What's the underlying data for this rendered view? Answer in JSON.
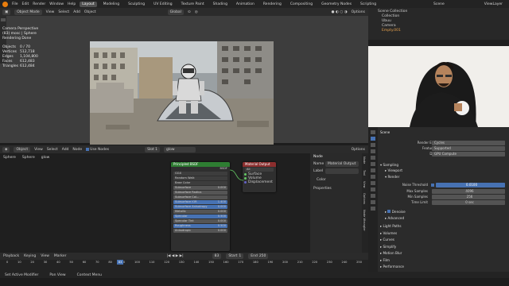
{
  "topbar": {
    "menus": [
      "File",
      "Edit",
      "Render",
      "Window",
      "Help"
    ],
    "workspaces": [
      "Layout",
      "Modeling",
      "Sculpting",
      "UV Editing",
      "Texture Paint",
      "Shading",
      "Animation",
      "Rendering",
      "Compositing",
      "Geometry Nodes",
      "Scripting"
    ],
    "active_workspace": "Layout",
    "scene": "Scene",
    "view_layer": "ViewLayer"
  },
  "viewport": {
    "mode": "Object Mode",
    "menus": [
      "View",
      "Select",
      "Add",
      "Object"
    ],
    "transform": "Global",
    "options": "Options",
    "overlay": {
      "camera": "Camera Perspective",
      "object": "(83) mosc | Sphere",
      "status": "Rendering Done",
      "stats": [
        {
          "label": "Objects",
          "value": "0 / 70"
        },
        {
          "label": "Vertices",
          "value": "512,718"
        },
        {
          "label": "Edges",
          "value": "1,104,800"
        },
        {
          "label": "Faces",
          "value": "612,483"
        },
        {
          "label": "Triangles",
          "value": "612,484"
        }
      ]
    }
  },
  "node_editor": {
    "type": "Object",
    "menus": [
      "View",
      "Select",
      "Add",
      "Node"
    ],
    "use_nodes": "Use Nodes",
    "slot": "Slot 1",
    "material": "glow",
    "options": "Options",
    "breadcrumb": [
      "Sphere",
      "Sphere",
      "glow"
    ],
    "bsdf": {
      "title": "Principled BSDF",
      "output": "BSDF",
      "distribution": "GGX",
      "subsurface_method": "Random Walk",
      "rows": [
        "Base Color",
        "Subsurface",
        "Subsurface Radius",
        "Subsurface Col...",
        "Subsurface IOR",
        "Subsurface Anisotropy",
        "Metallic",
        "Specular",
        "Specular Tint",
        "Roughness",
        "Anisotropic"
      ],
      "values": [
        "",
        "0.000",
        "",
        "",
        "1.400",
        "0.000",
        "0.000",
        "0.500",
        "0.000",
        "0.500",
        "0.000"
      ]
    },
    "output_node": {
      "title": "Material Output",
      "target": "All",
      "inputs": [
        "Surface",
        "Volume",
        "Displacement"
      ]
    },
    "sidebar": {
      "section": "Node",
      "name_label": "Name",
      "name_value": "Material Output",
      "label_label": "Label",
      "color": "Color",
      "properties": "Properties"
    },
    "tabs": [
      "Node",
      "Tool",
      "View",
      "Options",
      "Node Wrangler"
    ]
  },
  "timeline": {
    "menus": [
      "Playback",
      "Keying",
      "View",
      "Marker"
    ],
    "start_label": "Start",
    "start": "1",
    "end_label": "End",
    "end": "250",
    "current": "83",
    "ticks": [
      "0",
      "10",
      "20",
      "30",
      "40",
      "50",
      "60",
      "70",
      "80",
      "90",
      "100",
      "110",
      "120",
      "130",
      "140",
      "150",
      "160",
      "170",
      "180",
      "190",
      "200",
      "210",
      "220",
      "230",
      "240",
      "250"
    ]
  },
  "statusbar": {
    "items": [
      "Set Active Modifier",
      "Pan View",
      "Context Menu"
    ]
  },
  "outliner": {
    "items": [
      "Scene Collection",
      "Collection",
      "Ubuu",
      "Camera",
      "Empty.001"
    ]
  },
  "properties": {
    "title": "Scene",
    "render_engine_label": "Render Engine",
    "render_engine": "Cycles",
    "feature_set_label": "Feature Set",
    "feature_set": "Supported",
    "device_label": "Device",
    "device": "GPU Compute",
    "sampling": "Sampling",
    "viewport": "Viewport",
    "render": "Render",
    "noise_threshold_label": "Noise Threshold",
    "noise_threshold": "0.0100",
    "max_samples_label": "Max Samples",
    "max_samples": "4096",
    "min_samples_label": "Min Samples",
    "min_samples": "256",
    "time_limit_label": "Time Limit",
    "time_limit": "0 sec",
    "denoise": "Denoise",
    "advanced": "Advanced",
    "sections": [
      "Light Paths",
      "Volumes",
      "Curves",
      "Simplify",
      "Motion Blur",
      "Film",
      "Performance"
    ]
  },
  "colors": {
    "accent": "#4772b3",
    "bsdf_header": "#2e7d32",
    "output_header": "#8b2e2e",
    "playhead": "#4772b3"
  }
}
